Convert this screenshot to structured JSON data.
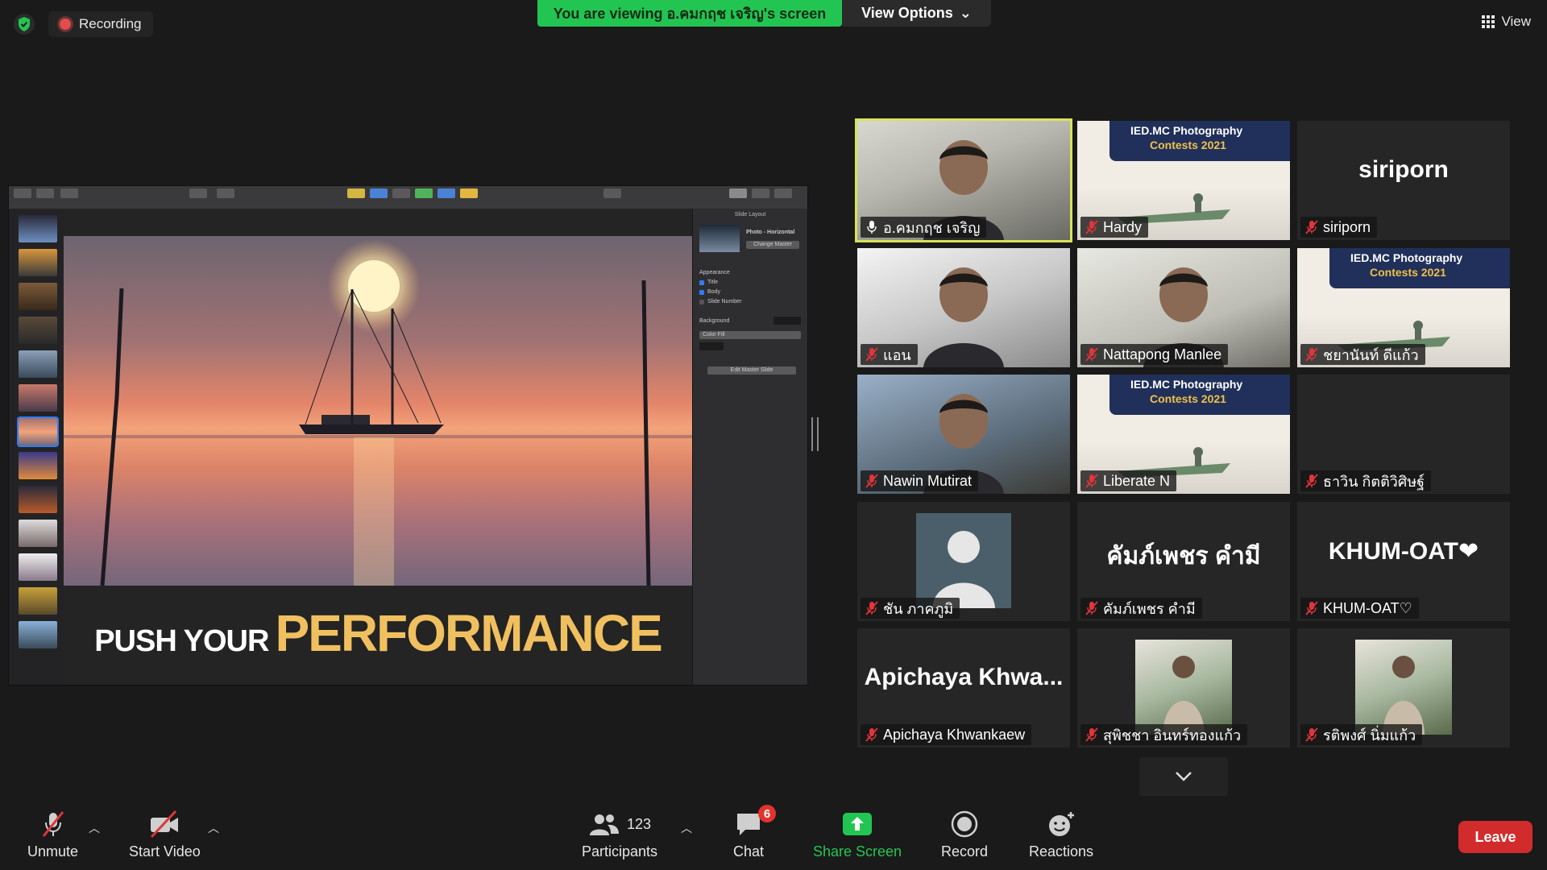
{
  "top": {
    "recording_label": "Recording",
    "viewing_banner": "You are viewing อ.คมกฤช เจริญ's screen",
    "view_options_label": "View Options",
    "view_label": "View"
  },
  "shared_screen": {
    "slide_caption_a": "PUSH YOUR",
    "slide_caption_b": "PERFORMANCE",
    "inspector": {
      "tab_label": "Slide Layout",
      "master_name": "Photo - Horizontal",
      "change_master": "Change Master",
      "appearance": "Appearance",
      "opt_title": "Title",
      "opt_body": "Body",
      "opt_slide_number": "Slide Number",
      "background": "Background",
      "fill_type": "Color Fill",
      "edit_master": "Edit Master Slide"
    }
  },
  "participants": [
    {
      "name": "อ.คมกฤช เจริญ",
      "type": "video",
      "active": true
    },
    {
      "name": "Hardy",
      "type": "poster"
    },
    {
      "name": "siriporn",
      "type": "text",
      "big": "siriporn"
    },
    {
      "name": "แอน",
      "type": "video"
    },
    {
      "name": "Nattapong Manlee",
      "type": "video"
    },
    {
      "name": "ชยานันท์ ดีแก้ว",
      "type": "poster"
    },
    {
      "name": "Nawin Mutirat",
      "type": "video"
    },
    {
      "name": "Liberate N",
      "type": "poster"
    },
    {
      "name": "ธาวิน กิตติวิศิษฐ์",
      "type": "blank"
    },
    {
      "name": "ชัน ภาคภูมิ",
      "type": "avatar"
    },
    {
      "name": "คัมภ์เพชร คำมี",
      "type": "text",
      "big": "คัมภ์เพชร คำมี"
    },
    {
      "name": "KHUM-OAT♡",
      "type": "text",
      "big": "KHUM-OAT❤"
    },
    {
      "name": "Apichaya Khwankaew",
      "type": "text",
      "big": "Apichaya  Khwa..."
    },
    {
      "name": "สุพิชชา อินทร์ทองแก้ว",
      "type": "photo"
    },
    {
      "name": "รติพงศ์ นิ่มแก้ว",
      "type": "photo"
    }
  ],
  "poster_text": {
    "line1": "IED.MC Photography",
    "line2": "Contests 2021"
  },
  "controls": {
    "unmute": "Unmute",
    "start_video": "Start Video",
    "participants": "Participants",
    "participants_count": "123",
    "chat": "Chat",
    "chat_badge": "6",
    "share_screen": "Share Screen",
    "record": "Record",
    "reactions": "Reactions",
    "leave": "Leave"
  },
  "colors": {
    "share_green": "#23c552",
    "active_speaker": "#d6e35a",
    "leave_red": "#d22b2b",
    "mute_red": "#e0353a"
  }
}
